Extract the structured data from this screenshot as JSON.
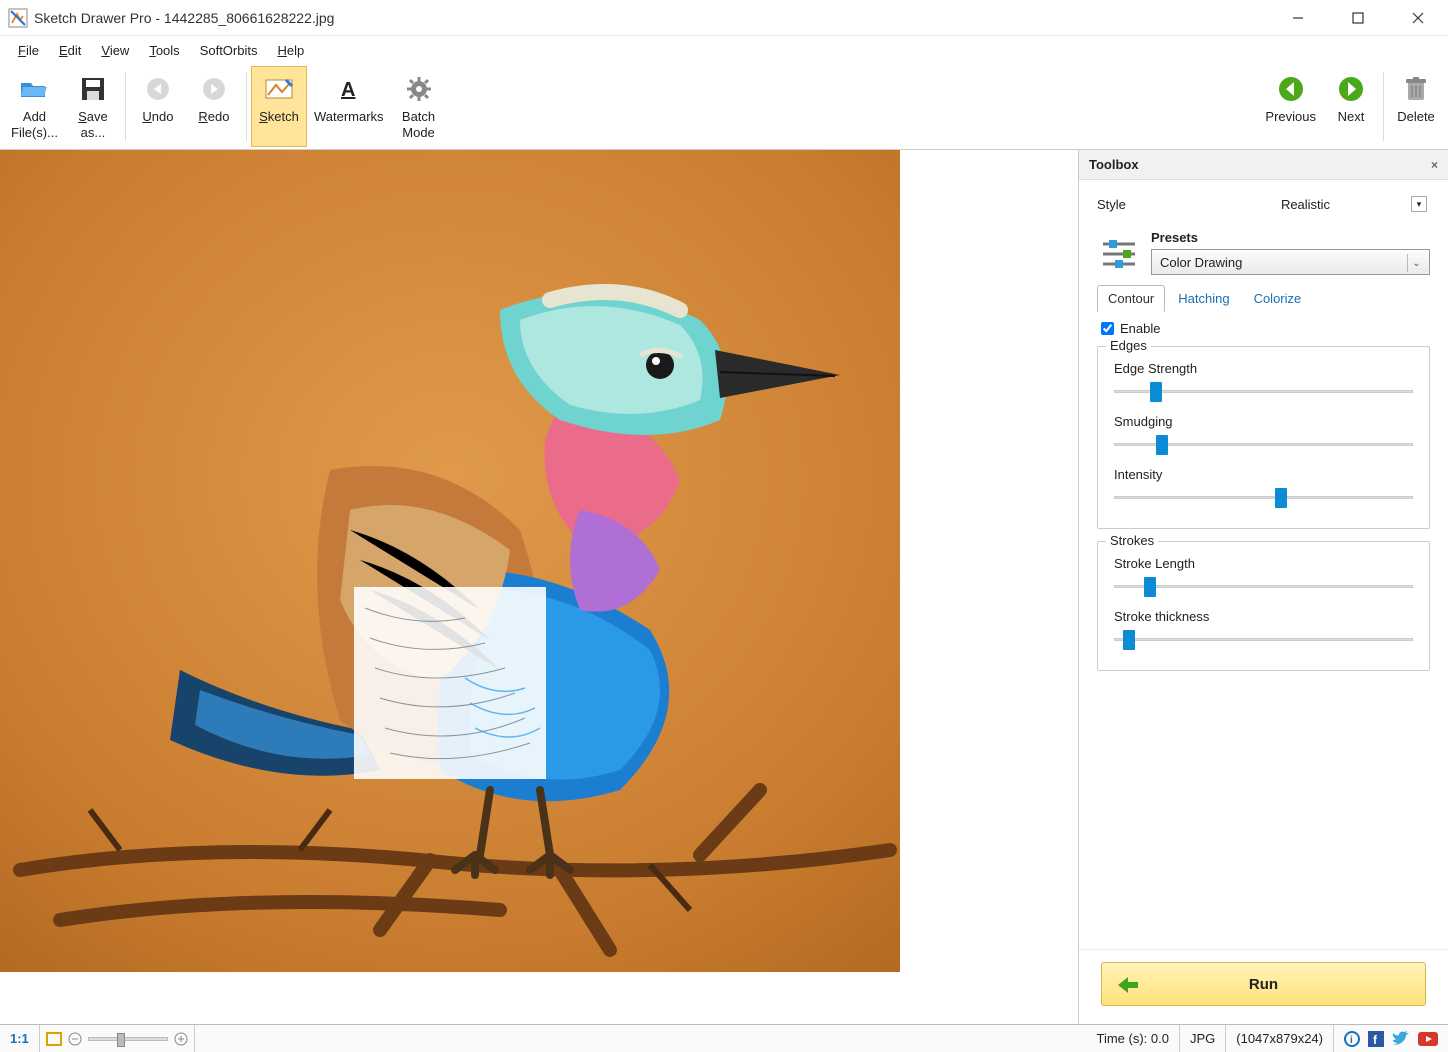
{
  "window": {
    "title": "Sketch Drawer Pro - 1442285_80661628222.jpg"
  },
  "menubar": {
    "items": [
      {
        "label_pre": "",
        "mn": "F",
        "label_post": "ile"
      },
      {
        "label_pre": "",
        "mn": "E",
        "label_post": "dit"
      },
      {
        "label_pre": "",
        "mn": "V",
        "label_post": "iew"
      },
      {
        "label_pre": "",
        "mn": "T",
        "label_post": "ools"
      },
      {
        "label_pre": "SoftOrbits",
        "mn": "",
        "label_post": ""
      },
      {
        "label_pre": "",
        "mn": "H",
        "label_post": "elp"
      }
    ]
  },
  "toolbar": {
    "add_files": "Add\nFile(s)...",
    "save_as": "Save\nas...",
    "undo": "Undo",
    "redo": "Redo",
    "sketch": "Sketch",
    "watermarks": "Watermarks",
    "batch_mode": "Batch\nMode",
    "previous": "Previous",
    "next": "Next",
    "delete": "Delete"
  },
  "toolbox": {
    "title": "Toolbox",
    "style_label": "Style",
    "style_value": "Realistic",
    "presets_title": "Presets",
    "presets_value": "Color Drawing",
    "tabs": [
      "Contour",
      "Hatching",
      "Colorize"
    ],
    "active_tab": 0,
    "enable_label": "Enable",
    "enable_checked": true,
    "edges": {
      "legend": "Edges",
      "edge_strength": {
        "label": "Edge Strength",
        "value": 12
      },
      "smudging": {
        "label": "Smudging",
        "value": 14
      },
      "intensity": {
        "label": "Intensity",
        "value": 54
      }
    },
    "strokes": {
      "legend": "Strokes",
      "stroke_length": {
        "label": "Stroke Length",
        "value": 10
      },
      "stroke_thickness": {
        "label": "Stroke thickness",
        "value": 3
      }
    },
    "run_label": "Run"
  },
  "statusbar": {
    "ratio": "1:1",
    "time": "Time (s): 0.0",
    "format": "JPG",
    "dimensions": "(1047x879x24)"
  }
}
